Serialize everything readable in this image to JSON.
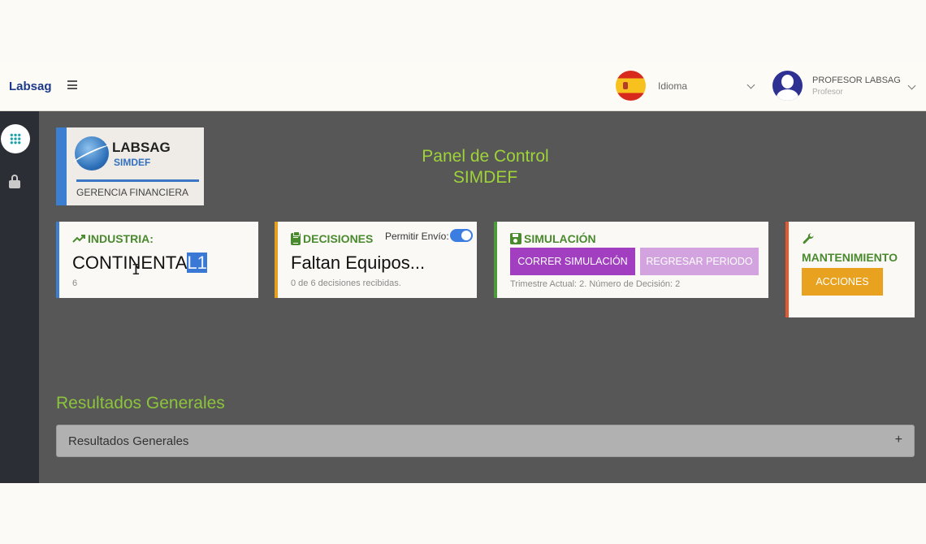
{
  "topbar": {
    "brand": "Labsag",
    "language_label": "Idioma",
    "user_name": "PROFESOR LABSAG",
    "user_role": "Profesor"
  },
  "logo": {
    "title": "LABSAG",
    "subtitle": "SIMDEF",
    "caption": "GERENCIA FINANCIERA"
  },
  "panel": {
    "title_line1": "Panel de Control",
    "title_line2": "SIMDEF"
  },
  "industria": {
    "label": "INDUSTRIA:",
    "value_main": "CONTINENTA",
    "value_selected": "L1",
    "sub": "6"
  },
  "decisiones": {
    "label": "DECISIONES",
    "toggle_label": "Permitir Envío:",
    "toggle_on": true,
    "value": "Faltan Equipos...",
    "sub": "0 de 6 decisiones recibidas."
  },
  "simulacion": {
    "label": "SIMULACIÓN",
    "run_button": "CORRER SIMULACIÓN",
    "back_button": "REGRESAR PERIODO",
    "status": "Trimestre Actual: 2. Número de Decisión: 2"
  },
  "mantenimiento": {
    "label": "MANTENIMIENTO",
    "button": "ACCIONES"
  },
  "results": {
    "heading": "Resultados Generales",
    "accordion_label": "Resultados Generales",
    "accordion_toggle": "+"
  },
  "colors": {
    "brand": "#1c3a8a",
    "accent_green": "#9ed33a",
    "run_purple": "#a13fc0",
    "action_orange": "#e8a21f",
    "toggle_blue": "#3b7de0"
  },
  "icons": [
    "menu-icon",
    "flag-spain-icon",
    "chevron-down-icon",
    "user-avatar-icon",
    "apps-grid-icon",
    "lock-icon",
    "trending-up-icon",
    "clipboard-icon",
    "save-icon",
    "wrench-icon",
    "plus-icon"
  ]
}
